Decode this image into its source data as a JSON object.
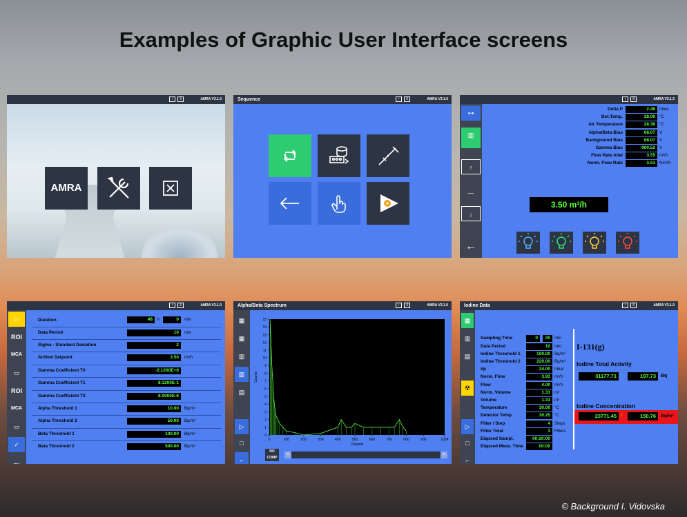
{
  "slide_title": "Examples of Graphic User Interface screens",
  "credit": "© Background I. Vidovska",
  "colors": {
    "panel_blue": "#4f7ff0",
    "titlebar": "#2d3544",
    "value_green": "#5dff3c",
    "alarm_red": "#e8151b"
  },
  "panel1": {
    "version": "AMRA V3.1.0",
    "amra_label": "AMRA"
  },
  "panel2": {
    "title": "Sequence",
    "version": "AMRA V3.1.0"
  },
  "panel3": {
    "version": "AMRA V3.1.0",
    "rows": [
      {
        "label": "Delta P",
        "value": "2.46",
        "unit": "mbar"
      },
      {
        "label": "Det.Temp.",
        "value": "28.00",
        "unit": "°C"
      },
      {
        "label": "Air Temperature",
        "value": "28.36",
        "unit": "°C"
      },
      {
        "label": "Alpha/Beta Bias",
        "value": "68.07",
        "unit": "V"
      },
      {
        "label": "Background Bias",
        "value": "68.07",
        "unit": "V"
      },
      {
        "label": "Gamma Bias",
        "value": "900.52",
        "unit": "V"
      },
      {
        "label": "Flow Rate Inlet",
        "value": "3.55",
        "unit": "m³/h"
      },
      {
        "label": "Norm. Flow Rate",
        "value": "3.51",
        "unit": "Nm³/h"
      }
    ],
    "flow_display": "3.50 m³/h"
  },
  "panel4": {
    "version": "AMRA V3.1.0",
    "side_labels": [
      "ROI",
      "MCA",
      "ROI",
      "MCA"
    ],
    "duration": {
      "label": "Duration",
      "hours": "48",
      "h_unit": "h",
      "minutes": "0",
      "min_unit": "min"
    },
    "rows": [
      {
        "label": "Data Period",
        "value": "10",
        "unit": "min"
      },
      {
        "label": "Sigma - Standard Deviation",
        "value": "2",
        "unit": ""
      },
      {
        "label": "Airflow Setpoint",
        "value": "3.50",
        "unit": "m³/h"
      },
      {
        "label": "Gamma Coefficient T0",
        "value": "-2.1200E+0",
        "unit": ""
      },
      {
        "label": "Gamma Coefficient T1",
        "value": "8.1200E-1",
        "unit": ""
      },
      {
        "label": "Gamma Coefficient T2",
        "value": "8.0000E-6",
        "unit": ""
      },
      {
        "label": "Alpha Threshold 1",
        "value": "10.00",
        "unit": "Bq/m³"
      },
      {
        "label": "Alpha Threshold 2",
        "value": "50.00",
        "unit": "Bq/m³"
      },
      {
        "label": "Beta Threshold 1",
        "value": "100.00",
        "unit": "Bq/m³"
      },
      {
        "label": "Beta Threshold 2",
        "value": "500.00",
        "unit": "Bq/m³"
      }
    ]
  },
  "panel5": {
    "title": "Alpha/Beta Spectrum",
    "version": "AMRA V3.1.0",
    "no_comp": "NO COMP",
    "chart_data": {
      "type": "line",
      "xlabel": "Channel",
      "ylabel": "Counts",
      "xlim": [
        0,
        1024
      ],
      "ylim": [
        0,
        15
      ],
      "x_ticks": [
        "0",
        "100",
        "200",
        "300",
        "400",
        "500",
        "600",
        "700",
        "800",
        "900",
        "1024"
      ],
      "y_ticks": [
        "0",
        "1",
        "2",
        "3",
        "4",
        "5",
        "6",
        "7",
        "8",
        "9",
        "10",
        "11",
        "12",
        "13",
        "14",
        "15"
      ],
      "x": [
        5,
        10,
        15,
        20,
        25,
        30,
        35,
        40,
        50,
        60,
        80,
        100,
        150,
        200,
        300,
        400,
        420,
        450,
        480,
        500,
        550,
        600,
        650,
        700,
        730,
        760,
        780,
        800
      ],
      "y": [
        15,
        12,
        9,
        7,
        5,
        4,
        3,
        2.5,
        2,
        1.5,
        1,
        0.5,
        0.3,
        0,
        0.2,
        1,
        2,
        1,
        1,
        1.5,
        1,
        1,
        1,
        1,
        1,
        2,
        1,
        0.5
      ]
    }
  },
  "panel6": {
    "title": "Iodine Data",
    "version": "AMRA V3.1.0",
    "time": {
      "label": "Sampling Time",
      "hours": "0",
      "minutes": "20",
      "unit": "min"
    },
    "rows": [
      {
        "label": "Data Period",
        "value": "10",
        "unit": "min"
      },
      {
        "label": "Iodine Threshold 1",
        "value": "100.00",
        "unit": "Bq/m³"
      },
      {
        "label": "Iodine Threshold 2",
        "value": "220.00",
        "unit": "Bq/m³"
      },
      {
        "label": "dp",
        "value": "24.00",
        "unit": "mbar"
      },
      {
        "label": "Norm. Flow",
        "value": "3.93",
        "unit": "m³/h"
      },
      {
        "label": "Flow",
        "value": "4.00",
        "unit": "m³/h"
      },
      {
        "label": "Norm. Volume",
        "value": "1.31",
        "unit": "m³"
      },
      {
        "label": "Volume",
        "value": "1.33",
        "unit": "m³"
      },
      {
        "label": "Temperature",
        "value": "30.00",
        "unit": "°C"
      },
      {
        "label": "Detector Temp.",
        "value": "30.25",
        "unit": "°C"
      },
      {
        "label": "Filter / Step",
        "value": "4",
        "unit": "Steps"
      },
      {
        "label": "Filter Total",
        "value": "3",
        "unit": "Filters"
      },
      {
        "label": "Elapsed Sampl.",
        "value": "00:20:00",
        "unit": ""
      },
      {
        "label": "Elapsed Meas. Time",
        "value": "00:00",
        "unit": ""
      }
    ],
    "isotope": "I-131(g)",
    "activity_label": "Iodine Total Activity",
    "activity_value": "31177.71",
    "activity_rate": "197.73",
    "activity_unit": "Bq",
    "concentration_label": "Iodine Concentration",
    "concentration_value": "23771.45",
    "concentration_rate": "150.76",
    "concentration_unit": "Bq/m³"
  }
}
